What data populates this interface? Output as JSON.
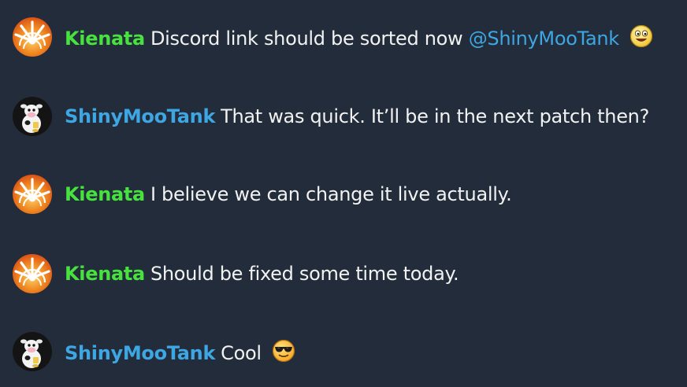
{
  "messages": [
    {
      "user": "Kienata",
      "text": "Discord link should be sorted now",
      "mention": "@ShinyMooTank",
      "emoji": "smile-emoji",
      "avatar": "sunburst-avatar"
    },
    {
      "user": "ShinyMooTank",
      "text": "That was quick. It’ll be in the next patch then?",
      "avatar": "cow-avatar"
    },
    {
      "user": "Kienata",
      "text": "I believe we can change it live actually.",
      "avatar": "sunburst-avatar"
    },
    {
      "user": "Kienata",
      "text": "Should be fixed some time today.",
      "avatar": "sunburst-avatar"
    },
    {
      "user": "ShinyMooTank",
      "text": "Cool",
      "emoji": "sunglasses-emoji",
      "avatar": "cow-avatar"
    }
  ],
  "colors": {
    "background": "#222c3a",
    "kienata": "#47e23e",
    "shinymootank": "#3ea6e3",
    "mention": "#3ea6e3",
    "text": "#f2f2f2"
  }
}
